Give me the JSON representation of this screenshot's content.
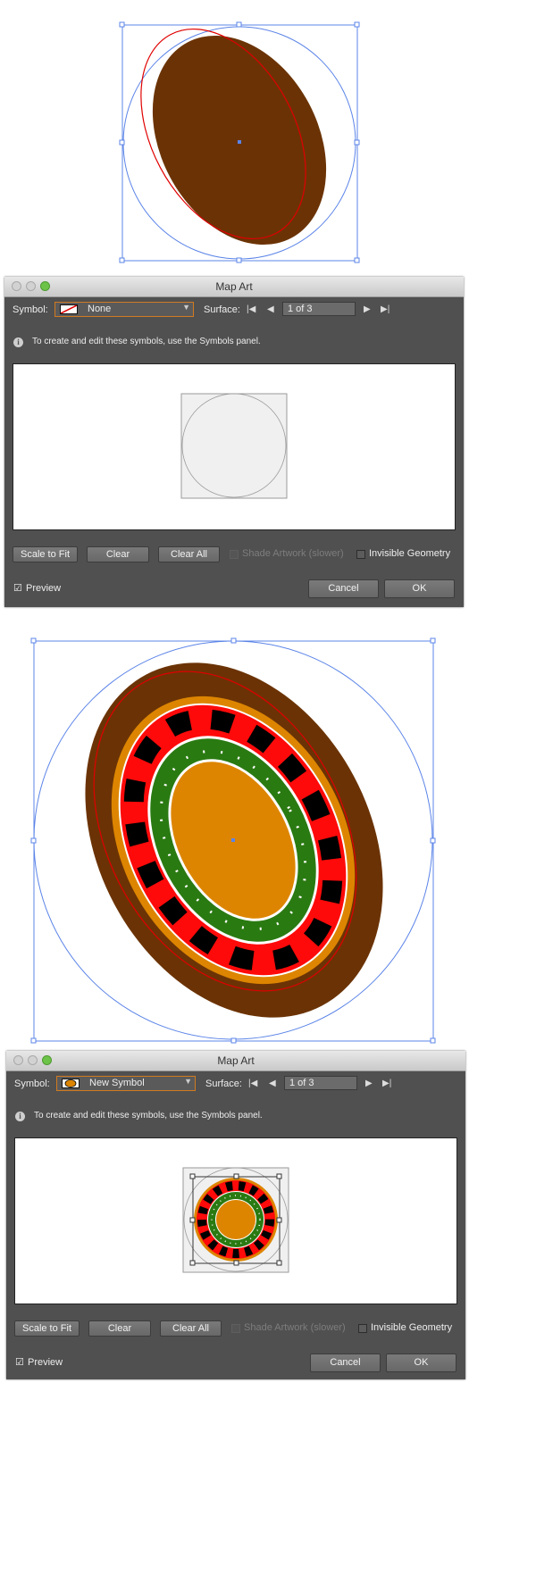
{
  "colors": {
    "rim_brown": "#6b3305",
    "accent_orange": "#dd8500",
    "red_pocket": "#ff0a0a",
    "black_pocket": "#000000",
    "green": "#2a7a12",
    "selection_blue": "#5b84e8",
    "path_red": "#e00000"
  },
  "dialog1": {
    "title": "Map Art",
    "symbol_label": "Symbol:",
    "symbol_value": "None",
    "surface_label": "Surface:",
    "surface_value": "1 of 3",
    "info_text": "To create and edit these symbols, use the Symbols panel.",
    "scale_to_fit": "Scale to Fit",
    "clear": "Clear",
    "clear_all": "Clear All",
    "shade_artwork": "Shade Artwork (slower)",
    "invisible_geometry": "Invisible Geometry",
    "preview": "Preview",
    "cancel": "Cancel",
    "ok": "OK"
  },
  "dialog2": {
    "title": "Map Art",
    "symbol_label": "Symbol:",
    "symbol_value": "New Symbol",
    "surface_label": "Surface:",
    "surface_value": "1 of 3",
    "info_text": "To create and edit these symbols, use the Symbols panel.",
    "scale_to_fit": "Scale to Fit",
    "clear": "Clear",
    "clear_all": "Clear All",
    "shade_artwork": "Shade Artwork (slower)",
    "invisible_geometry": "Invisible Geometry",
    "preview": "Preview",
    "cancel": "Cancel",
    "ok": "OK"
  }
}
